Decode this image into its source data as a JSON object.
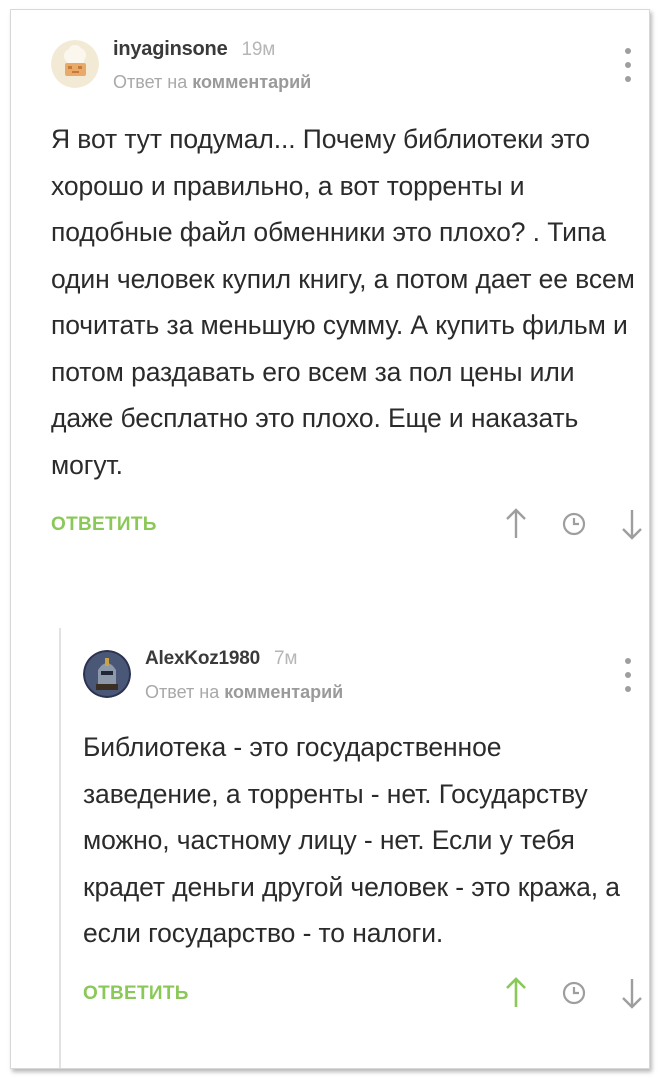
{
  "comments": [
    {
      "author": "inyaginsone",
      "time": "19м",
      "reply_prefix": "Ответ на",
      "reply_target": "комментарий",
      "body": "Я вот тут подумал... Почему библиотеки это хорошо и правильно, а вот торренты и подобные файл обменники это плохо? . Типа один человек купил книгу, а потом дает ее всем почитать за меньшую сумму. А купить фильм и потом раздавать его всем за пол цены или даже бесплатно это плохо. Еще и наказать могут.",
      "reply_label": "ОТВЕТИТЬ",
      "upvoted": false
    },
    {
      "author": "AlexKoz1980",
      "time": "7м",
      "reply_prefix": "Ответ на",
      "reply_target": "комментарий",
      "body": "Библиотека - это государственное заведение, а торренты - нет. Государству можно, частному лицу - нет. Если у тебя крадет деньги другой человек - это кража, а если государство - то налоги.",
      "reply_label": "ОТВЕТИТЬ",
      "upvoted": true
    }
  ],
  "colors": {
    "accent_green": "#8ac858",
    "icon_gray": "#9e9e9e",
    "meta_gray": "#a8a8a8"
  },
  "icons": {
    "more": "kebab-menu-icon",
    "upvote": "arrow-up-icon",
    "save": "clock-icon",
    "downvote": "arrow-down-icon"
  }
}
